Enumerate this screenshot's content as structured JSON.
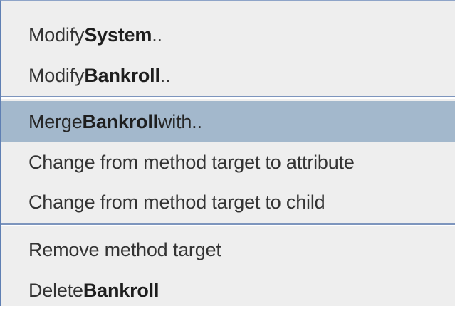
{
  "menu": {
    "items": [
      {
        "prefix": "Modify ",
        "bold": "System",
        "suffix": ".."
      },
      {
        "prefix": "Modify ",
        "bold": "Bankroll",
        "suffix": ".."
      },
      {
        "prefix": "Merge ",
        "bold": "Bankroll",
        "suffix": " with.."
      },
      {
        "prefix": "Change from method target to attribute",
        "bold": "",
        "suffix": ""
      },
      {
        "prefix": "Change from method target to child",
        "bold": "",
        "suffix": ""
      },
      {
        "prefix": "Remove method target",
        "bold": "",
        "suffix": ""
      },
      {
        "prefix": "Delete ",
        "bold": "Bankroll",
        "suffix": ""
      }
    ],
    "selected_index": 2,
    "colors": {
      "background": "#eeeeee",
      "selected": "#a3b8cc",
      "separator": "#7d95bd",
      "border": "#5f7fb3"
    }
  }
}
